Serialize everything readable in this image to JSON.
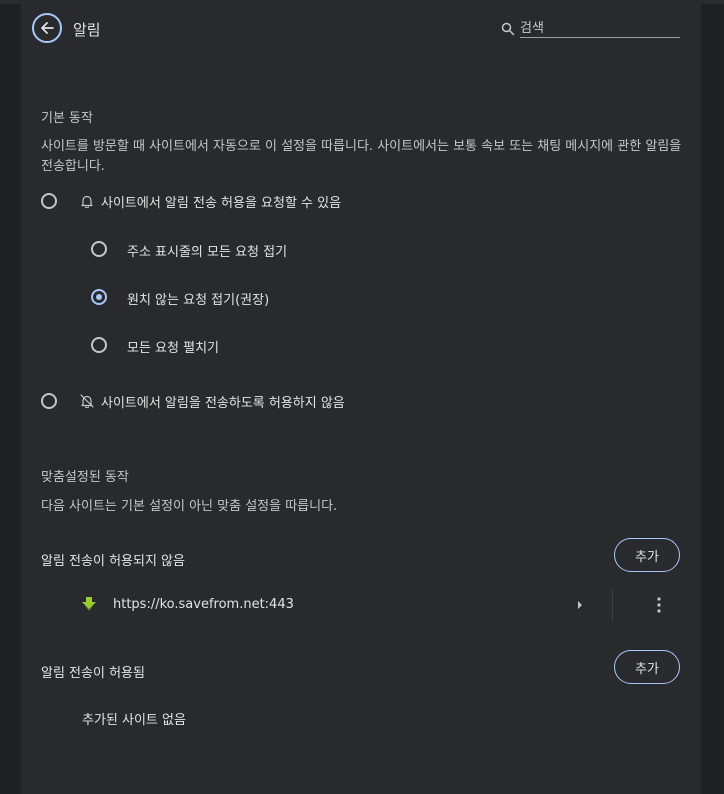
{
  "header": {
    "title": "알림",
    "search_placeholder": "검색"
  },
  "default_behavior": {
    "title": "기본 동작",
    "description": "사이트를 방문할 때 사이트에서 자동으로 이 설정을 따릅니다. 사이트에서는 보통 속보 또는 채팅 메시지에 관한 알림을 전송합니다.",
    "options": [
      {
        "label": "사이트에서 알림 전송 허용을 요청할 수 있음",
        "icon": "bell-icon",
        "checked": false
      },
      {
        "label": "사이트에서 알림을 전송하도록 허용하지 않음",
        "icon": "bell-off-icon",
        "checked": false
      }
    ],
    "sub_options": [
      {
        "label": "주소 표시줄의 모든 요청 접기",
        "checked": false
      },
      {
        "label": "원치 않는 요청 접기(권장)",
        "checked": true
      },
      {
        "label": "모든 요청 펼치기",
        "checked": false
      }
    ]
  },
  "custom_behavior": {
    "title": "맞춤설정된 동작",
    "description": "다음 사이트는 기본 설정이 아닌 맞춤 설정을 따릅니다.",
    "blocked": {
      "title": "알림 전송이 허용되지 않음",
      "add_label": "추가",
      "sites": [
        {
          "url": "https://ko.savefrom.net:443",
          "icon": "savefrom-favicon-icon"
        }
      ]
    },
    "allowed": {
      "title": "알림 전송이 허용됨",
      "add_label": "추가",
      "empty_text": "추가된 사이트 없음"
    }
  },
  "colors": {
    "background": "#1f2023",
    "card": "#292a2d",
    "accent": "#a8c7fa",
    "text": "#e3e3e3",
    "favicon": "#9acd32"
  }
}
